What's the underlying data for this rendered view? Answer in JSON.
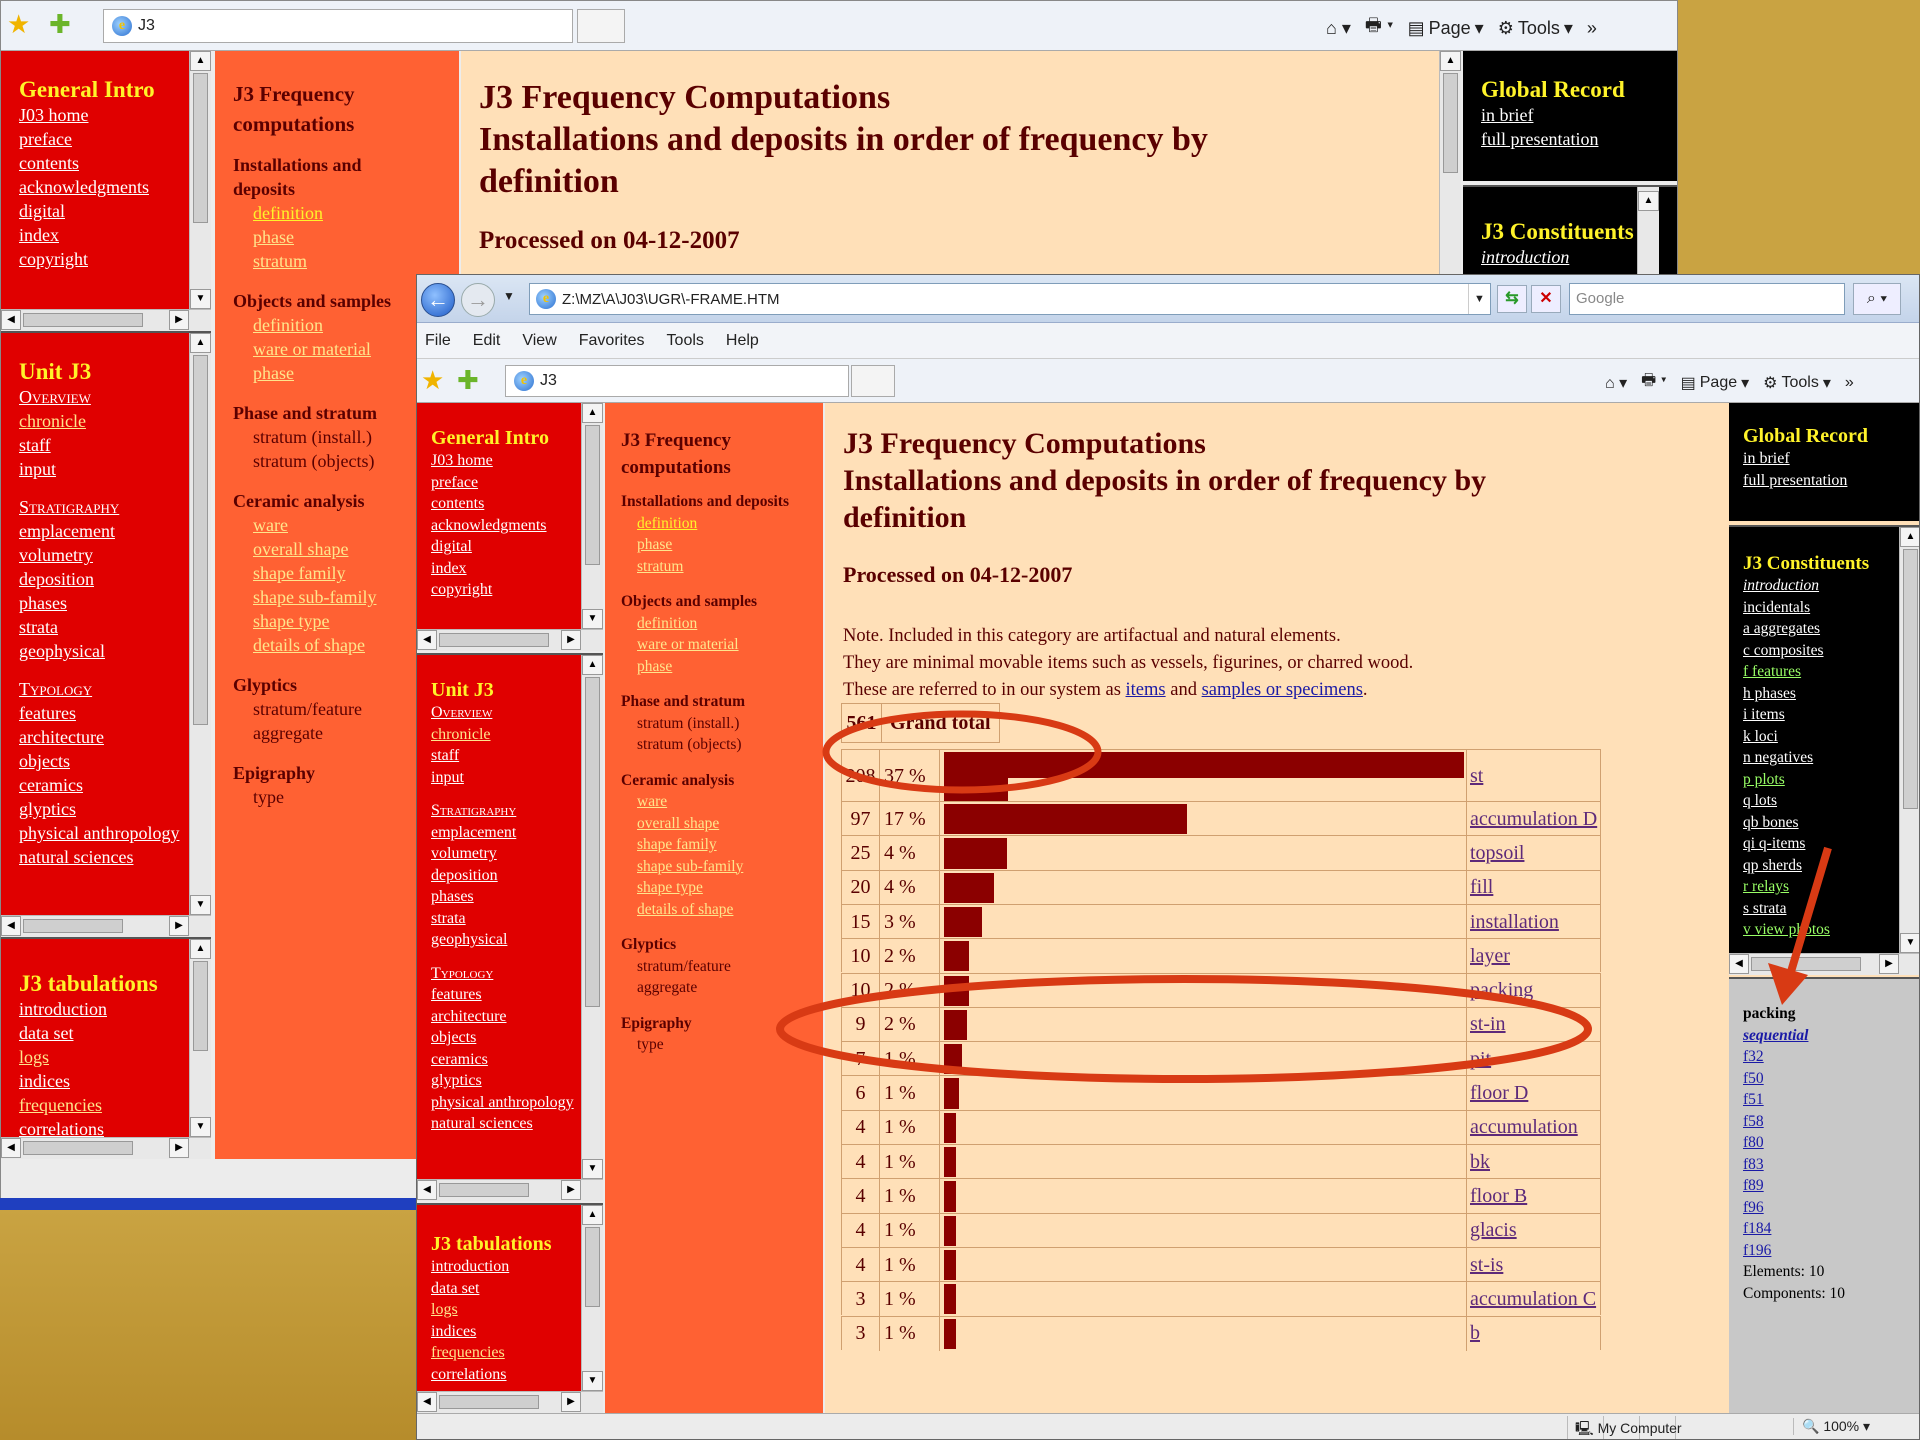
{
  "back_window": {
    "tab_title": "J3",
    "toolbar": {
      "page_label": "Page",
      "tools_label": "Tools",
      "chevron": "»"
    },
    "left_frames": {
      "general_intro": {
        "title": "General Intro",
        "links": [
          "J03 home",
          "preface",
          "contents",
          "acknowledgments",
          "digital",
          "index",
          "copyright"
        ]
      },
      "unit": {
        "title": "Unit J3",
        "overview": "Overview",
        "links1": [
          "chronicle",
          "staff",
          "input"
        ],
        "stratigraphy": "Stratigraphy",
        "links2": [
          "emplacement",
          "volumetry",
          "deposition",
          "phases",
          "strata",
          "geophysical"
        ],
        "typology": "Typology",
        "links3": [
          "features",
          "architecture",
          "objects",
          "ceramics",
          "glyptics",
          "physical anthropology",
          "natural sciences"
        ]
      },
      "tabulations": {
        "title": "J3 tabulations",
        "links": [
          "introduction",
          "data set",
          "logs",
          "indices",
          "frequencies",
          "correlations"
        ]
      }
    },
    "outline": {
      "title": "J3 Frequency computations",
      "groups": [
        {
          "heading": "Installations and deposits",
          "items": [
            "definition",
            "phase",
            "stratum"
          ]
        },
        {
          "heading": "Objects and samples",
          "items": [
            "definition",
            "ware or material",
            "phase"
          ]
        },
        {
          "heading": "Phase and stratum",
          "items": [
            "stratum (install.)",
            "stratum (objects)"
          ]
        },
        {
          "heading": "Ceramic analysis",
          "items": [
            "ware",
            "overall shape",
            "shape family",
            "shape sub-family",
            "shape type",
            "details of shape"
          ]
        },
        {
          "heading": "Glyptics",
          "items": [
            "stratum/feature",
            "aggregate"
          ]
        },
        {
          "heading": "Epigraphy",
          "items": [
            "type"
          ]
        }
      ]
    },
    "main": {
      "title_line1": "J3 Frequency Computations",
      "title_line2": "Installations and deposits in order of frequency by",
      "title_line3": "definition",
      "processed": "Processed on 04-12-2007"
    },
    "right": {
      "global_title": "Global Record",
      "global_links": [
        "in brief",
        "full presentation"
      ],
      "constituents_title": "J3 Constituents",
      "constituents_first": "introduction"
    }
  },
  "front_window": {
    "address": "Z:\\MZ\\A\\J03\\UGR\\-FRAME.HTM",
    "search_placeholder": "Google",
    "menu": [
      "File",
      "Edit",
      "View",
      "Favorites",
      "Tools",
      "Help"
    ],
    "tab_title": "J3",
    "toolbar": {
      "page_label": "Page",
      "tools_label": "Tools",
      "chevron": "»"
    },
    "status": {
      "zone": "My Computer",
      "zoom": "100%"
    },
    "left_frames": {
      "general_intro": {
        "title": "General Intro",
        "links": [
          "J03 home",
          "preface",
          "contents",
          "acknowledgments",
          "digital",
          "index",
          "copyright"
        ]
      },
      "unit": {
        "title": "Unit J3",
        "overview": "Overview",
        "links1": [
          "chronicle",
          "staff",
          "input"
        ],
        "stratigraphy": "Stratigraphy",
        "links2": [
          "emplacement",
          "volumetry",
          "deposition",
          "phases",
          "strata",
          "geophysical"
        ],
        "typology": "Typology",
        "links3": [
          "features",
          "architecture",
          "objects",
          "ceramics",
          "glyptics",
          "physical anthropology",
          "natural sciences"
        ]
      },
      "tabulations": {
        "title": "J3 tabulations",
        "links": [
          "introduction",
          "data set",
          "logs",
          "indices",
          "frequencies",
          "correlations"
        ]
      }
    },
    "outline": {
      "title": "J3 Frequency computations",
      "groups": [
        {
          "heading": "Installations and deposits",
          "items": [
            "definition",
            "phase",
            "stratum"
          ]
        },
        {
          "heading": "Objects and samples",
          "items": [
            "definition",
            "ware or material",
            "phase"
          ]
        },
        {
          "heading": "Phase and stratum",
          "items": [
            "stratum (install.)",
            "stratum (objects)"
          ]
        },
        {
          "heading": "Ceramic analysis",
          "items": [
            "ware",
            "overall shape",
            "shape family",
            "shape sub-family",
            "shape type",
            "details of shape"
          ]
        },
        {
          "heading": "Glyptics",
          "items": [
            "stratum/feature",
            "aggregate"
          ]
        },
        {
          "heading": "Epigraphy",
          "items": [
            "type"
          ]
        }
      ]
    },
    "main": {
      "title_line1": "J3 Frequency Computations",
      "title_line2": "Installations and deposits in order of frequency by",
      "title_line3": "definition",
      "processed": "Processed on 04-12-2007",
      "note_line1": "Note. Included in this category are artifactual and natural elements.",
      "note_line2": "They are minimal movable items such as vessels, figurines, or charred wood.",
      "note_line3_pre": "These are referred to in our system as",
      "note_link1": "items",
      "note_and": "and",
      "note_link2": "samples or specimens",
      "note_end": ".",
      "grand_total_count": "561",
      "grand_total_label": "Grand total"
    },
    "right": {
      "global_title": "Global Record",
      "global_links": [
        "in brief",
        "full presentation"
      ],
      "constituents_title": "J3 Constituents",
      "constituents": [
        "introduction",
        "incidentals",
        "a aggregates",
        "c composites",
        "f features",
        "h phases",
        "i items",
        "k loci",
        "n negatives",
        "p plots",
        "q lots",
        "qb bones",
        "qi q-items",
        "qp sherds",
        "r relays",
        "s strata",
        "v view photos"
      ],
      "detail_title": "packing",
      "detail_sub": "sequential",
      "detail_links": [
        "f32",
        "f50",
        "f51",
        "f58",
        "f80",
        "f83",
        "f89",
        "f96",
        "f184",
        "f196"
      ],
      "elements": "Elements: 10",
      "components": "Components: 10"
    }
  },
  "chart_data": {
    "type": "bar",
    "title": "Installations and deposits in order of frequency by definition",
    "total": 561,
    "categories": [
      "st",
      "accumulation D",
      "topsoil",
      "fill",
      "installation",
      "layer",
      "packing",
      "st-in",
      "pit",
      "floor D",
      "accumulation",
      "bk",
      "floor B",
      "glacis",
      "st-is",
      "accumulation C",
      "b"
    ],
    "values": [
      208,
      97,
      25,
      20,
      15,
      10,
      10,
      9,
      7,
      6,
      4,
      4,
      4,
      4,
      4,
      3,
      3
    ],
    "percent_labels": [
      "37 %",
      "17 %",
      "4 %",
      "4 %",
      "3 %",
      "2 %",
      "2 %",
      "2 %",
      "1 %",
      "1 %",
      "1 %",
      "1 %",
      "1 %",
      "1 %",
      "1 %",
      "1 %",
      "1 %"
    ],
    "highlighted_category": "packing"
  },
  "colors": {
    "nav_red": "#e00000",
    "outline_orange": "#ff6133",
    "main_peach": "#ffe0b8",
    "bar": "#8b0000",
    "annotation": "#d83a14",
    "heading_yellow": "#fff32a"
  }
}
